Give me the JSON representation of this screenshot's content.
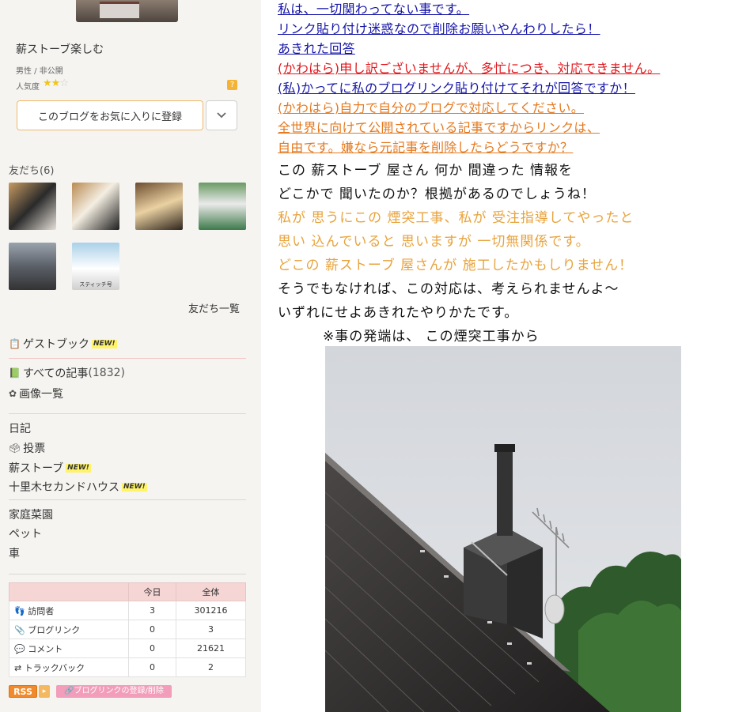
{
  "profile": {
    "name": "薪ストーブ楽しむ",
    "meta": "男性 / 非公開",
    "popularity_label": "人気度",
    "popularity_stars": 2,
    "popularity_max": 3,
    "help_glyph": "?",
    "favorite_button": "このブログをお気に入りに登録"
  },
  "friends": {
    "title": "友だち(6)",
    "thumb6_caption": "スティッチ号",
    "all_link": "友だち一覧"
  },
  "nav": {
    "guestbook": "ゲストブック",
    "new_badge": "NEW!",
    "all_articles": "すべての記事",
    "all_articles_count": "(1832)",
    "image_list": "画像一覧",
    "diary": "日記",
    "vote": "投票",
    "stove": "薪ストーブ",
    "jurigi": "十里木セカンドハウス",
    "garden": "家庭菜園",
    "pet": "ペット",
    "car": "車"
  },
  "stats": {
    "headers": [
      "",
      "今日",
      "全体"
    ],
    "rows": [
      {
        "label": "訪問者",
        "today": "3",
        "total": "301216"
      },
      {
        "label": "ブログリンク",
        "today": "0",
        "total": "3"
      },
      {
        "label": "コメント",
        "today": "0",
        "total": "21621"
      },
      {
        "label": "トラックバック",
        "today": "0",
        "total": "2"
      }
    ]
  },
  "badges": {
    "rss": "RSS",
    "rss_arrow": "▸",
    "bloglink": "ブログリンクの登録/削除"
  },
  "article": {
    "lines": [
      "私は、一切関わってない事です。",
      "リンク貼り付け迷惑なので削除お願いやんわりしたら！",
      "あきれた回答",
      "(かわはら)申し訳ございませんが、多忙につき、対応できません。",
      "(私)かってに私のブログリンク貼り付けてそれが回答ですか！",
      "(かわはら)自力で自分のブログで対応してください。",
      "全世界に向けて公開されている記事ですからリンクは、",
      "自由です。嫌なら元記事を削除したらどうですか？",
      "この 薪ストーブ 屋さん 何か 間違った 情報を",
      "どこかで 聞いたのか？根拠があるのでしょうね！",
      "私が 思うにこの 煙突工事、私が 受注指導してやったと",
      "思い 込んでいると 思いますが 一切無関係です。",
      "どこの 薪ストーブ 屋さんが 施工したかもしりません！",
      "そうでもなければ、この対応は、考えられませんよ〜",
      "いずれにせよあきれたやりかたです。",
      "※事の発端は、 この煙突工事から"
    ]
  },
  "colors": {
    "sidebar_bg": "#f5f4f1",
    "link_blue": "#1515a8",
    "link_red": "#e0161b",
    "link_orange": "#e4791e",
    "text_orange": "#e8a33c",
    "button_border": "#f1b86b",
    "table_header": "#f6d5d5"
  }
}
